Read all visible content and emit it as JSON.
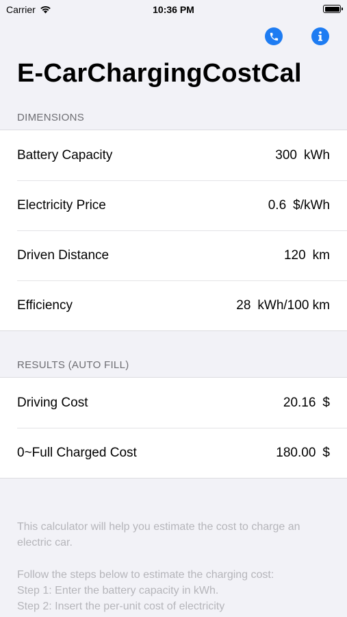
{
  "status_bar": {
    "carrier": "Carrier",
    "time": "10:36 PM"
  },
  "nav": {
    "phone_icon": "phone-icon",
    "info_icon": "info-icon",
    "accent": "#1e7cf2"
  },
  "title": "E-CarChargingCostCal",
  "dimensions": {
    "header": "DIMENSIONS",
    "rows": [
      {
        "label": "Battery Capacity",
        "value": "300",
        "unit": "kWh"
      },
      {
        "label": "Electricity Price",
        "value": "0.6",
        "unit": "$/kWh"
      },
      {
        "label": "Driven Distance",
        "value": "120",
        "unit": "km"
      },
      {
        "label": "Efficiency",
        "value": "28",
        "unit": "kWh/100 km"
      }
    ]
  },
  "results": {
    "header": "RESULTS (AUTO FILL)",
    "rows": [
      {
        "label": "Driving Cost",
        "value": "20.16",
        "unit": "$"
      },
      {
        "label": "0~Full Charged Cost",
        "value": "180.00",
        "unit": "$"
      }
    ]
  },
  "footer": {
    "intro": "This calculator will help you estimate the cost to charge an electric car.",
    "steps_intro": "Follow the steps below to estimate the charging cost:",
    "step1": "Step 1: Enter the battery capacity in kWh.",
    "step2": "Step 2: Insert the per-unit cost of electricity"
  }
}
